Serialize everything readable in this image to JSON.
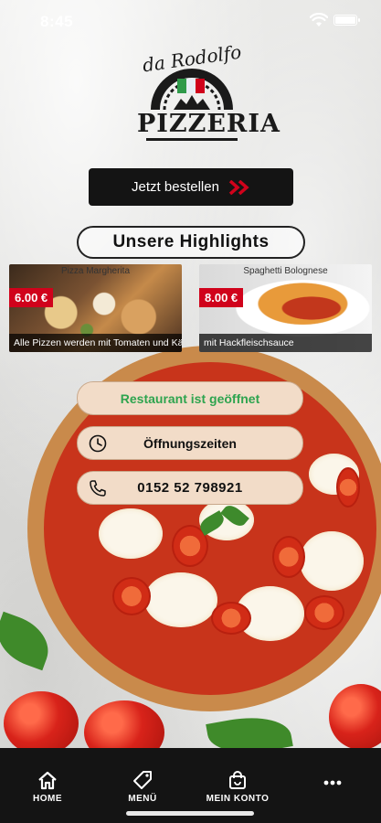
{
  "status_bar": {
    "time": "8:45"
  },
  "logo": {
    "script": "da Rodolfo",
    "word": "PIZZERIA"
  },
  "order_button": {
    "label": "Jetzt bestellen",
    "icon": "double-chevron-right-icon",
    "icon_color": "#d0021b"
  },
  "highlights": {
    "title": "Unsere Highlights",
    "items": [
      {
        "title": "Pizza Margherita",
        "price": "6.00 €",
        "description": "Alle Pizzen werden mit Tomaten und Käse..."
      },
      {
        "title": "Spaghetti Bolognese",
        "price": "8.00 €",
        "description": "mit Hackfleischsauce"
      }
    ]
  },
  "info": {
    "status": "Restaurant ist geöffnet",
    "status_color": "#2ea44f",
    "hours_label": "Öffnungszeiten",
    "hours_icon": "clock-icon",
    "phone": "0152 52 798921",
    "phone_icon": "phone-icon"
  },
  "bottom_nav": {
    "items": [
      {
        "label": "HOME",
        "icon": "home-icon"
      },
      {
        "label": "MENÜ",
        "icon": "tag-icon"
      },
      {
        "label": "MEIN KONTO",
        "icon": "bag-icon"
      },
      {
        "label": "...",
        "icon": "more-icon"
      }
    ]
  },
  "colors": {
    "accent_red": "#d0021b",
    "nav_bg": "#141414",
    "pill_bg": "#f2dcc8"
  }
}
